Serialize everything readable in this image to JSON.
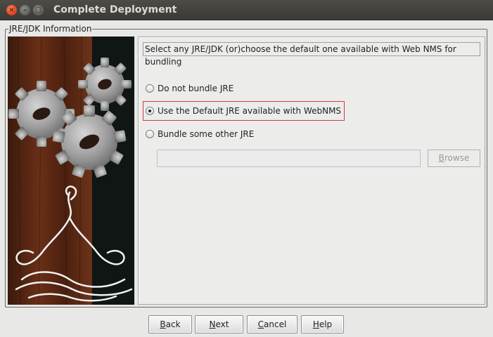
{
  "window": {
    "title": "Complete Deployment"
  },
  "titlebar_buttons": {
    "close": "×",
    "minimize": "–",
    "maximize": "□"
  },
  "group": {
    "legend": "JRE/JDK Information"
  },
  "panel": {
    "header": "Select any JRE/JDK (or)choose the default one available with Web NMS for bundling",
    "options": [
      {
        "label": "Do not bundle JRE",
        "checked": false
      },
      {
        "label": "Use the Default JRE available with WebNMS",
        "checked": true
      },
      {
        "label": "Bundle some other JRE",
        "checked": false
      }
    ],
    "jre_path_value": "",
    "browse": {
      "mnemonic": "B",
      "rest": "rowse"
    }
  },
  "buttons": {
    "back": {
      "mnemonic": "B",
      "rest": "ack"
    },
    "next": {
      "mnemonic": "N",
      "rest": "ext"
    },
    "cancel": {
      "mnemonic": "C",
      "rest": "ancel"
    },
    "help": {
      "mnemonic": "H",
      "rest": "elp"
    }
  }
}
